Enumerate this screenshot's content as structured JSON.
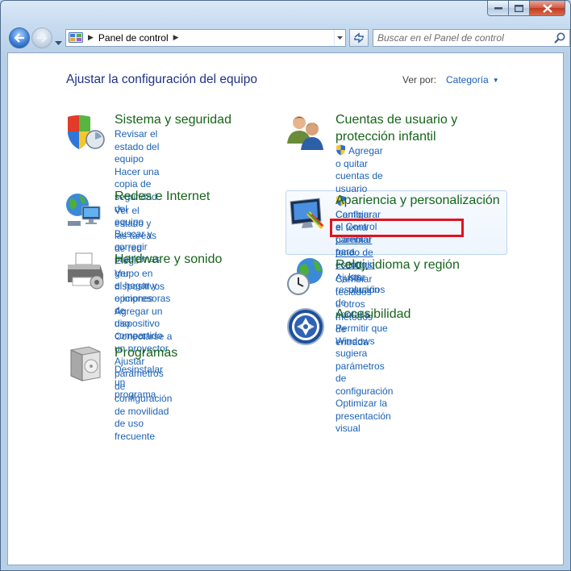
{
  "window": {
    "caption_min": "minimize",
    "caption_max": "maximize",
    "caption_close": "close"
  },
  "nav": {
    "address": "Panel de control",
    "search_placeholder": "Buscar en el Panel de control"
  },
  "main": {
    "title": "Ajustar la configuración del equipo",
    "viewby_label": "Ver por:",
    "viewby_value": "Categoría"
  },
  "categories": [
    {
      "icon": "shield-computer-icon",
      "title": "Sistema y seguridad",
      "links": [
        "Revisar el estado del equipo",
        "Hacer una copia de seguridad del",
        "equipo",
        "Buscar y corregir problemas"
      ]
    },
    {
      "icon": "network-globe-icon",
      "title": "Redes e Internet",
      "links": [
        "Ver el estado y las tareas de red",
        "Elegir grupo en el hogar y opciones de",
        "uso compartido"
      ]
    },
    {
      "icon": "printer-icon",
      "title": "Hardware y sonido",
      "links": [
        "Ver dispositivos e impresoras",
        "Agregar un dispositivo",
        "Conectarse a un proyector",
        "Ajustar parámetros de configuración",
        "de movilidad de uso frecuente"
      ]
    },
    {
      "icon": "programs-box-icon",
      "title": "Programas",
      "links": [
        "Desinstalar un programa"
      ]
    },
    {
      "icon": "users-icon",
      "title_line1": "Cuentas de usuario y",
      "title_line2": "protección infantil",
      "links": [
        "Agregar o quitar cuentas de usuario",
        "Configurar el Control parental para",
        "todos los usuarios"
      ]
    },
    {
      "icon": "monitor-paint-icon",
      "title": "Apariencia y personalización",
      "links": [
        "Cambiar el tema",
        "Cambiar fondo de escritorio",
        "Ajustar resolución de pantalla"
      ]
    },
    {
      "icon": "clock-globe-icon",
      "title": "Reloj, idioma y región",
      "links": [
        "Cambiar teclados u otros métodos de",
        "entrada"
      ]
    },
    {
      "icon": "accessibility-icon",
      "title": "Accesibilidad",
      "links": [
        "Permitir que Windows sugiera",
        "parámetros de configuración",
        "Optimizar la presentación visual"
      ]
    }
  ],
  "colors": {
    "title_green": "#17641a",
    "link_blue": "#1b61b5",
    "heading_blue": "#1e3287",
    "annotation_red": "#e0131d"
  }
}
